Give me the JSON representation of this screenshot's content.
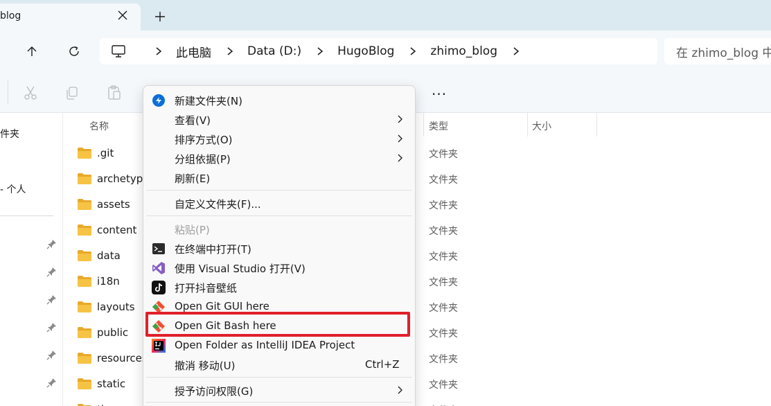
{
  "tab": {
    "title": "blog",
    "close_glyph": "✕",
    "new_glyph": "+"
  },
  "address": {
    "crumbs": [
      "此电脑",
      "Data (D:)",
      "HugoBlog",
      "zhimo_blog"
    ]
  },
  "search": {
    "placeholder": "在 zhimo_blog 中"
  },
  "toolbar": {
    "more_glyph": "..."
  },
  "nav_pane": {
    "items": [
      {
        "label": "件夹"
      },
      {
        "label": "- 个人"
      }
    ]
  },
  "columns": {
    "name": "名称",
    "type": "类型",
    "size": "大小"
  },
  "files": [
    {
      "name": ".git",
      "type": "文件夹"
    },
    {
      "name": "archetypes",
      "type": "文件夹"
    },
    {
      "name": "assets",
      "type": "文件夹"
    },
    {
      "name": "content",
      "type": "文件夹"
    },
    {
      "name": "data",
      "type": "文件夹"
    },
    {
      "name": "i18n",
      "type": "文件夹"
    },
    {
      "name": "layouts",
      "type": "文件夹"
    },
    {
      "name": "public",
      "type": "文件夹"
    },
    {
      "name": "resources",
      "type": "文件夹"
    },
    {
      "name": "static",
      "type": "文件夹"
    },
    {
      "name": "themes",
      "type": "文件夹"
    }
  ],
  "context_menu": {
    "items": [
      {
        "label": "新建文件夹(N)",
        "icon": "new-folder-icon"
      },
      {
        "label": "查看(V)",
        "submenu": true
      },
      {
        "label": "排序方式(O)",
        "submenu": true
      },
      {
        "label": "分组依据(P)",
        "submenu": true
      },
      {
        "label": "刷新(E)"
      },
      {
        "label": "自定义文件夹(F)..."
      },
      {
        "label": "粘贴(P)",
        "disabled": true
      },
      {
        "label": "在终端中打开(T)",
        "icon": "terminal-icon"
      },
      {
        "label": "使用 Visual Studio 打开(V)",
        "icon": "visual-studio-icon"
      },
      {
        "label": "打开抖音壁纸",
        "icon": "tiktok-icon"
      },
      {
        "label": "Open Git GUI here",
        "icon": "git-icon"
      },
      {
        "label": "Open Git Bash here",
        "icon": "git-icon",
        "highlighted": true
      },
      {
        "label": "Open Folder as IntelliJ IDEA Project",
        "icon": "intellij-icon"
      },
      {
        "label": "撤消 移动(U)",
        "shortcut": "Ctrl+Z"
      },
      {
        "label": "授予访问权限(G)",
        "submenu": true
      }
    ]
  },
  "colors": {
    "tabstrip_bg": "#dbe9f1",
    "chrome_bg": "#f4f8fb",
    "folder_yellow": "#f6c344",
    "highlight_red": "#e0202a",
    "git_orange": "#f05033",
    "git_green": "#3fa142"
  }
}
